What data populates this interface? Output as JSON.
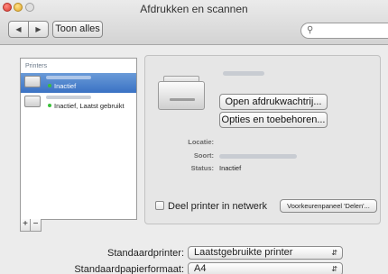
{
  "window": {
    "title": "Afdrukken en scannen"
  },
  "toolbar": {
    "back_glyph": "◀",
    "forward_glyph": "▶",
    "show_all_label": "Toon alles",
    "search_placeholder": ""
  },
  "sidebar": {
    "header": "Printers",
    "items": [
      {
        "status": "Inactief",
        "selected": true,
        "status_color": "#3bbf3b"
      },
      {
        "status": "Inactief, Laatst gebruikt",
        "selected": false,
        "status_color": "#3bbf3b"
      }
    ],
    "add_label": "+",
    "remove_label": "−"
  },
  "detail": {
    "open_queue_label": "Open afdrukwachtrij...",
    "options_label": "Opties en toebehoren...",
    "location_label": "Locatie:",
    "kind_label": "Soort:",
    "status_label": "Status:",
    "status_value": "Inactief",
    "share_label": "Deel printer in netwerk",
    "share_checked": false,
    "sharing_prefs_label": "Voorkeurenpaneel 'Delen'..."
  },
  "preferences": {
    "default_printer_label": "Standaardprinter:",
    "default_printer_value": "Laatstgebruikte printer",
    "default_paper_label": "Standaardpapierformaat:",
    "default_paper_value": "A4"
  },
  "colors": {
    "selection": "#3a72c4",
    "status_dot": "#3bbf3b"
  }
}
